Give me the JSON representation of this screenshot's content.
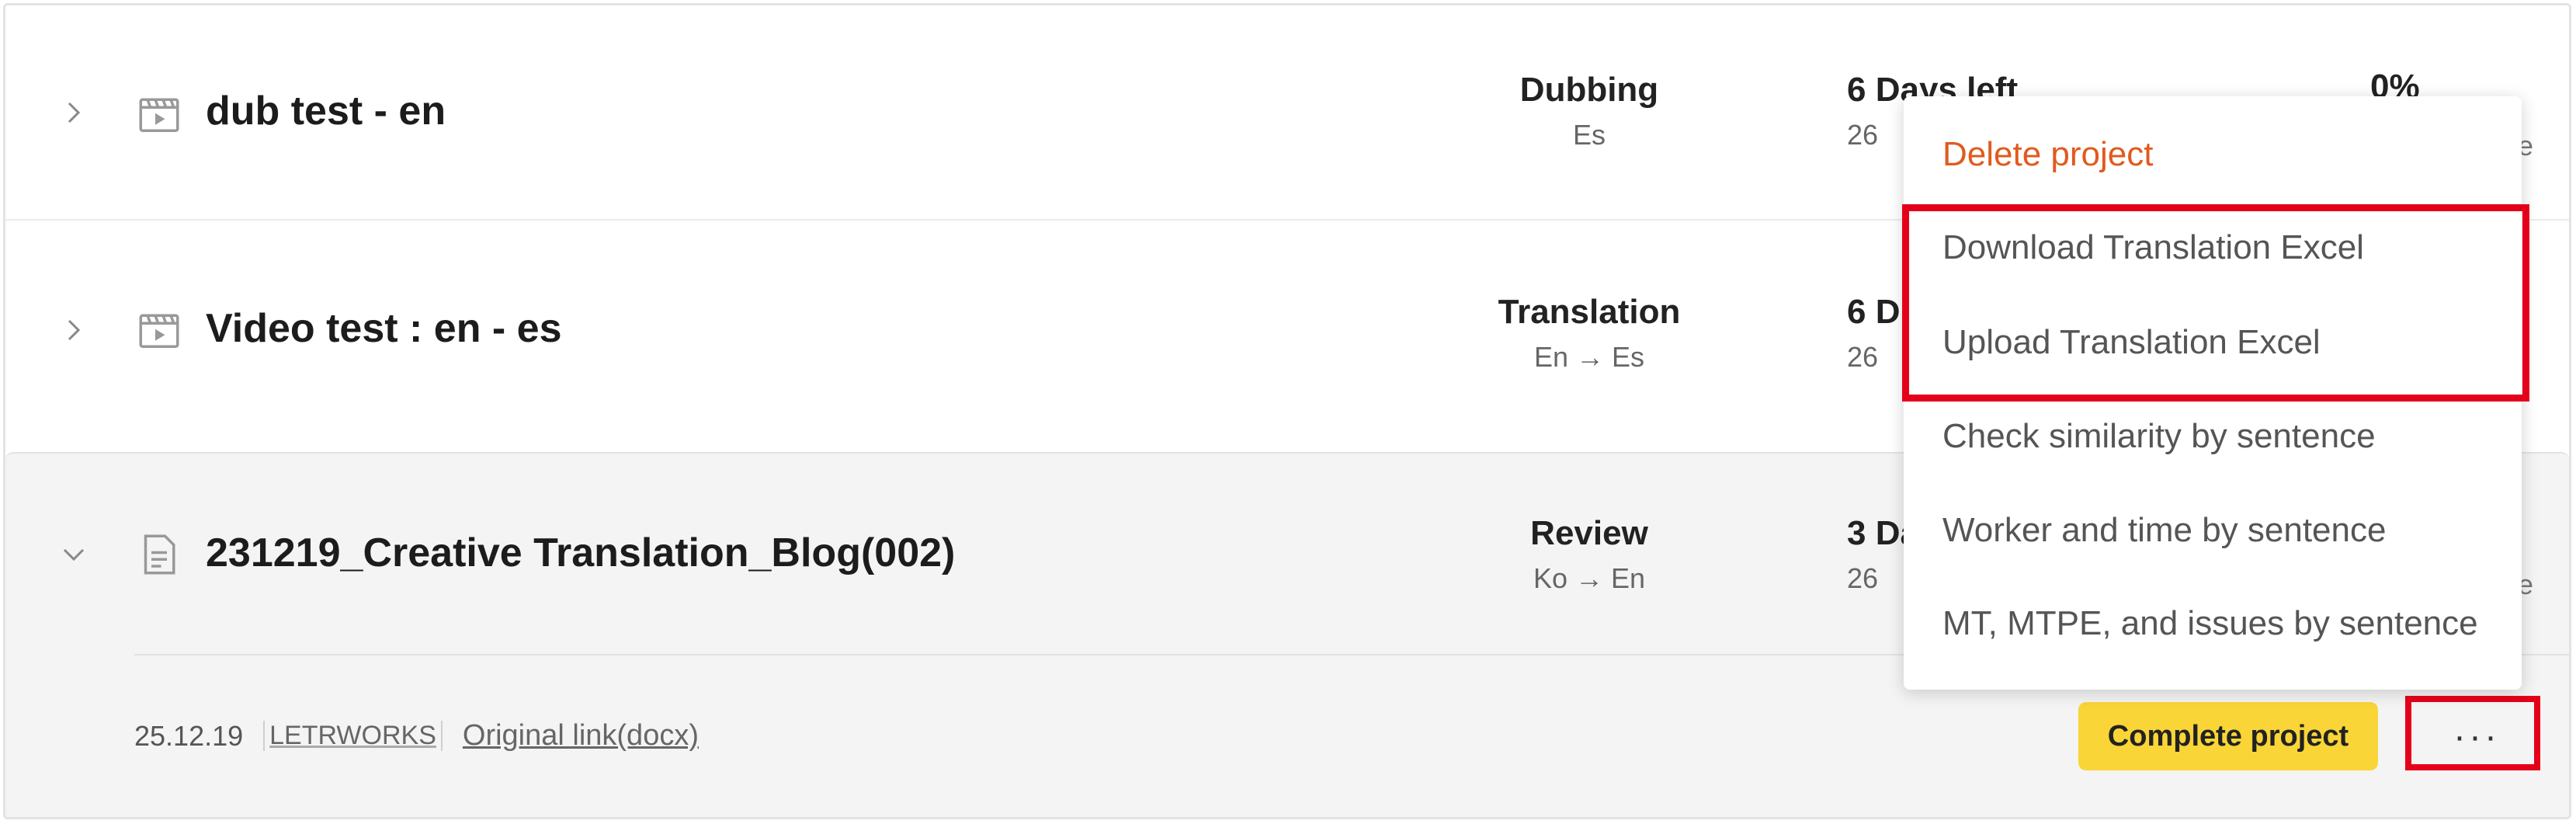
{
  "projects": [
    {
      "name": "dub test - en",
      "type": "Dubbing",
      "lang": "Es",
      "due": "6 Days left",
      "due_sub": "26",
      "percent": "0%",
      "peek": "e",
      "expanded": false,
      "file_icon": "video-icon"
    },
    {
      "name": "Video test : en - es",
      "type": "Translation",
      "lang": "En → Es",
      "due": "6 D",
      "due_sub": "26",
      "expanded": false,
      "file_icon": "video-icon"
    },
    {
      "name": "231219_Creative Translation_Blog(002)",
      "type": "Review",
      "lang": "Ko → En",
      "due": "3 Da",
      "due_sub": "26",
      "peek": "e",
      "expanded": true,
      "file_icon": "document-icon",
      "meta": {
        "date": "25.12.19",
        "team": "LETRWORKS",
        "link": "Original link(docx)"
      },
      "actions": {
        "complete": "Complete project",
        "more": "···"
      }
    }
  ],
  "menu": {
    "items": [
      {
        "label": "Delete project",
        "style": "danger"
      },
      {
        "label": "Download Translation Excel",
        "style": "normal"
      },
      {
        "label": "Upload Translation Excel",
        "style": "normal"
      },
      {
        "label": "Check similarity by sentence",
        "style": "normal"
      },
      {
        "label": "Worker and time by sentence",
        "style": "normal"
      },
      {
        "label": "MT, MTPE, and issues by sentence",
        "style": "normal"
      }
    ]
  },
  "colors": {
    "danger": "#e15a1e",
    "highlight": "#e5001a",
    "complete_button": "#f9d537"
  }
}
